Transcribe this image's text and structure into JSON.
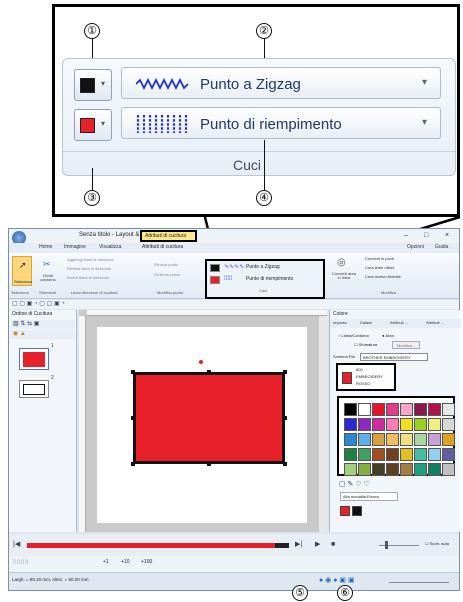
{
  "callout": {
    "stitch_line": "Punto a Zigzag",
    "stitch_fill": "Punto di riempimento",
    "group_label": "Cuci",
    "numbers": [
      "①",
      "②",
      "③",
      "④",
      "⑤",
      "⑥"
    ]
  },
  "app": {
    "title": "Senza titolo - Layout & Editing",
    "context_tab": "Attributi di cucitura",
    "window_buttons": [
      "–",
      "□",
      "×"
    ],
    "tabs": [
      "Home",
      "Immagine",
      "Visualizza",
      "Attributi di cucitura"
    ],
    "right_links": [
      "Opzioni",
      "Guida"
    ],
    "ribbon_left": {
      "select_label": "Seleziona",
      "divide_label": "Dividi contorno",
      "items": [
        "Aggiungi linea di direzione",
        "Elimina linea di direzione",
        "Inverti linea di direzione"
      ],
      "point_items": [
        "Elimina punto",
        "Dividi su punto"
      ],
      "group_labels": [
        "Seleziona",
        "Strumenti",
        "Linea direzione di cucitura",
        "Modifica punto"
      ]
    },
    "ribbon_mid": {
      "stitch_line": "Punto a Zigzag",
      "stitch_fill": "Punto di riempimento",
      "group_label": "Cuci"
    },
    "ribbon_right": {
      "convert_label": "Converti area in linea",
      "items": [
        "Converti in punti",
        "Crea linee offset",
        "Crea motivo floreale"
      ],
      "group_label": "Modifica"
    },
    "left_panel": {
      "title": "Ordine di Cucitura",
      "item_numbers": [
        "1",
        "2"
      ]
    },
    "right_panel": {
      "title": "Colore",
      "tabs": [
        "Importa",
        "Colore",
        "Attributi ...",
        "Attributi ..."
      ],
      "line_option": "Linea/Contorno",
      "area_option": "Area",
      "gradient_option": "Sfumatura",
      "modify_button": "Modifica...",
      "chart_label": "Schema Filo",
      "chart_value": "BROTHER EMBROIDERY",
      "thread_code": "800",
      "thread_brand": "EMBROIDERY",
      "thread_name": "ROSSO",
      "mode_button": "Alla modalità Elenco",
      "auto_scroll": "Scorr. auto"
    },
    "status": "Largh. = 80.10 mm, Altez. = 50.00 mm",
    "bottom_toolbar": [
      "+1",
      "+10",
      "+100"
    ],
    "palette": [
      [
        "#000000",
        "#ffffff",
        "#e8122a",
        "#e23d8d",
        "#f4a6c8",
        "#8a1a4a",
        "#b0124e",
        "#e8e8e8"
      ],
      [
        "#2a2ad0",
        "#8a2ac0",
        "#d02aa0",
        "#ff7ab8",
        "#f0e020",
        "#9ad020",
        "#f0f080",
        "#d8d8d8"
      ],
      [
        "#2a8ad0",
        "#60b0e8",
        "#d8a040",
        "#f0c060",
        "#f0e080",
        "#a8d8a0",
        "#c8a0d8",
        "#e0a020"
      ],
      [
        "#208040",
        "#40a060",
        "#a05020",
        "#704020",
        "#e0c020",
        "#40c0a0",
        "#90d0f0",
        "#6060a0"
      ],
      [
        "#a0d080",
        "#80b040",
        "#404020",
        "#604020",
        "#a08040",
        "#20a080",
        "#108060",
        "#c0c0c0"
      ]
    ],
    "colors": {
      "red": "#e8202a",
      "highlight": "#ffe88a",
      "accent": "#2a6ab8"
    }
  }
}
